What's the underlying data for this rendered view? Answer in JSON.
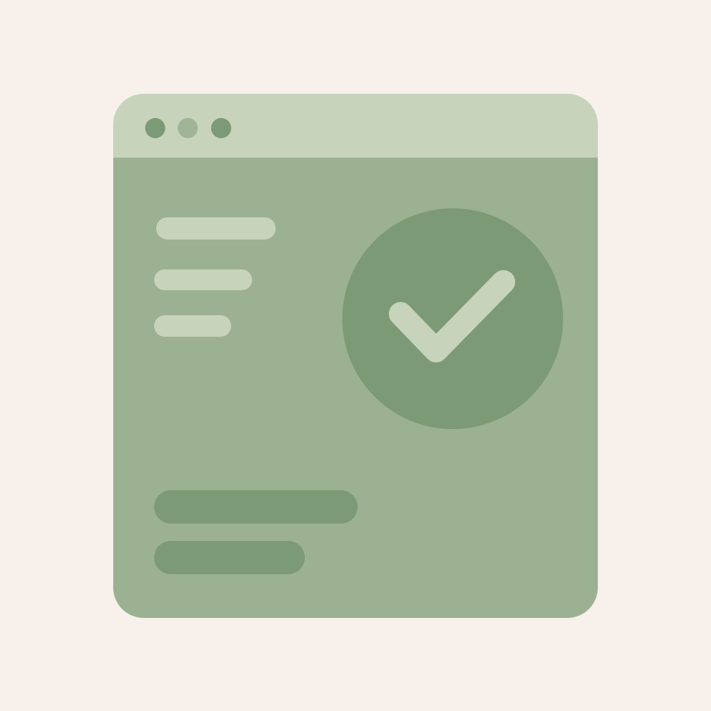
{
  "colors": {
    "background": "#f8f1eb",
    "titlebar": "#c8d3bb",
    "content": "#9cb191",
    "dot_dark": "#7c9a75",
    "dot_light": "#9fb595",
    "bar_light": "#c8d3bb",
    "bar_dark": "#7c9a75",
    "check_circle": "#7c9a75",
    "check_mark": "#c8d3bb"
  },
  "icons": {
    "window_controls": [
      "window-dot",
      "window-dot",
      "window-dot"
    ],
    "status": "checkmark-icon"
  }
}
